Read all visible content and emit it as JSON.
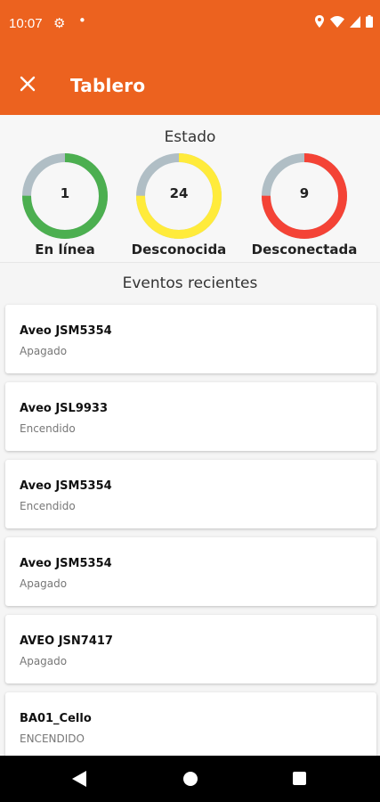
{
  "status_bar": {
    "time": "10:07",
    "icons": [
      "gear-icon",
      "dot-icon",
      "location-icon",
      "wifi-icon",
      "signal-icon",
      "battery-icon"
    ]
  },
  "app_bar": {
    "title": "Tablero",
    "close_icon": "close-icon",
    "color": "#ec621f"
  },
  "estado": {
    "title": "Estado",
    "gauges": [
      {
        "value": "1",
        "label": "En línea",
        "color": "#4caf50",
        "fraction": 0.75
      },
      {
        "value": "24",
        "label": "Desconocida",
        "color": "#ffeb3b",
        "fraction": 0.75
      },
      {
        "value": "9",
        "label": "Desconectada",
        "color": "#f44336",
        "fraction": 0.75
      }
    ]
  },
  "events": {
    "title": "Eventos recientes",
    "items": [
      {
        "title": "Aveo JSM5354",
        "subtitle": "Apagado"
      },
      {
        "title": "Aveo JSL9933",
        "subtitle": "Encendido"
      },
      {
        "title": "Aveo JSM5354",
        "subtitle": "Encendido"
      },
      {
        "title": "Aveo JSM5354",
        "subtitle": "Apagado"
      },
      {
        "title": "AVEO JSN7417",
        "subtitle": "Apagado"
      },
      {
        "title": "BA01_Cello",
        "subtitle": "ENCENDIDO"
      }
    ]
  },
  "nav_bar": {
    "icons": [
      "back-icon",
      "home-icon",
      "recents-icon"
    ]
  }
}
